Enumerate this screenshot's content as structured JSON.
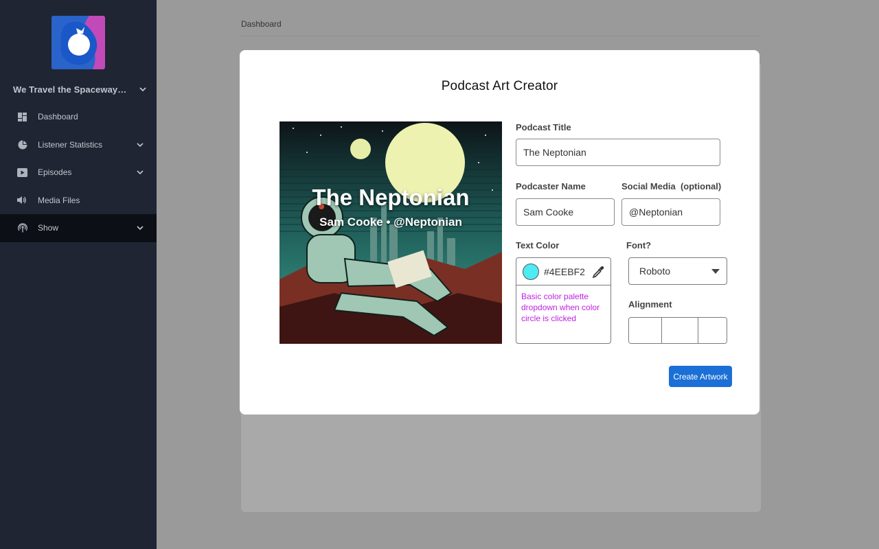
{
  "sidebar": {
    "show_name": "We Travel the Spaceways...",
    "items": [
      {
        "label": "Dashboard",
        "icon": "dashboard-icon"
      },
      {
        "label": "Listener Statistics",
        "icon": "pie-chart-icon"
      },
      {
        "label": "Episodes",
        "icon": "play-icon"
      },
      {
        "label": "Media Files",
        "icon": "speaker-icon"
      },
      {
        "label": "Show",
        "icon": "podcast-icon"
      }
    ]
  },
  "background": {
    "page_title": "Dashboard"
  },
  "modal": {
    "title": "Podcast Art Creator",
    "artwork": {
      "title": "The Neptonian",
      "subtitle": "Sam Cooke • @Neptonian"
    },
    "podcast_title": {
      "label": "Podcast Title",
      "value": "The Neptonian"
    },
    "podcaster_name": {
      "label": "Podcaster Name",
      "value": "Sam Cooke"
    },
    "social_media": {
      "label": "Social Media  (optional)",
      "value": "@Neptonian"
    },
    "text_color": {
      "label": "Text Color",
      "value": "#4EEBF2",
      "note": "Basic color palette dropdown when color circle is clicked"
    },
    "font": {
      "label": "Font?",
      "value": "Roboto"
    },
    "alignment": {
      "label": "Alignment"
    },
    "create_button": "Create Artwork"
  },
  "colors": {
    "sidebar_bg": "#1f2533",
    "active_item_bg": "#0c0f16",
    "primary_button": "#1b6fd6",
    "swatch": "#4EEBF2",
    "note_text": "#c020e0"
  }
}
